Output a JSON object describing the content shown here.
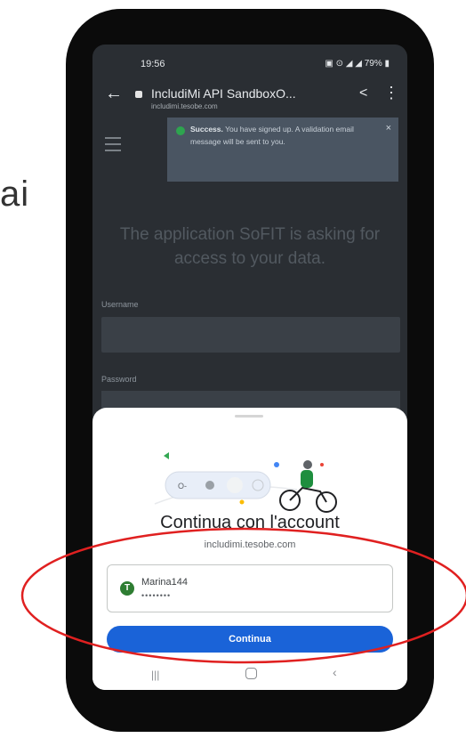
{
  "side_text": "ai",
  "status_bar": {
    "time": "19:56",
    "icons_text": "79%"
  },
  "browser": {
    "title": "IncludiMi API SandboxO...",
    "domain": "includimi.tesobe.com"
  },
  "toast": {
    "bold": "Success.",
    "message": " You have signed up. A validation email message will be sent to you.",
    "close": "×"
  },
  "page": {
    "headline": "The application SoFIT is asking for access to your data.",
    "username_label": "Username",
    "password_label": "Password"
  },
  "sheet": {
    "title": "Continua con l'account",
    "domain": "includimi.tesobe.com",
    "account": {
      "avatar_letter": "T",
      "name": "Marina144",
      "password_mask": "••••••••"
    },
    "continue_label": "Continua"
  },
  "colors": {
    "primary_button": "#1a63d8",
    "annotation_ellipse": "#e02020",
    "avatar": "#2e7d32"
  },
  "icons": [
    "back-arrow-icon",
    "lock-icon",
    "share-icon",
    "more-vert-icon",
    "menu-icon",
    "success-check-icon",
    "close-icon",
    "recents-icon",
    "home-icon",
    "nav-back-icon"
  ]
}
